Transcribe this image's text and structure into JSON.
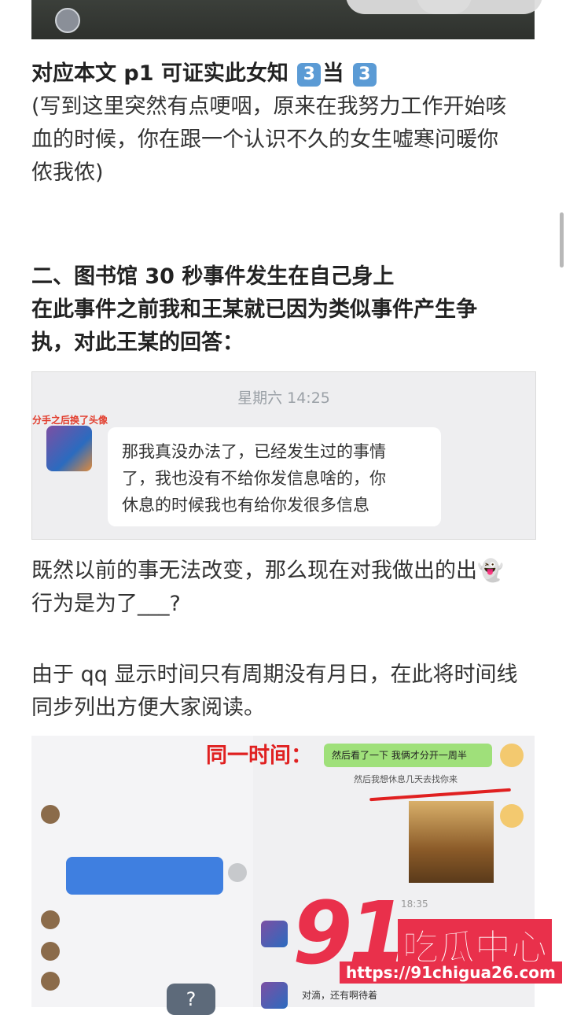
{
  "article": {
    "line1_prefix": "对应本文 p1 可证实此女知",
    "line1_badge1": "3",
    "line1_mid": "当",
    "line1_badge2": "3",
    "para1": [
      "(写到这里突然有点哽咽，原来在我努力工作开始咳",
      "血的时候，你在跟一个认识不久的女生嘘寒问暖你",
      "侬我侬)"
    ],
    "section2_title": "二、图书馆 30 秒事件发生在自己身上",
    "section2_lines": [
      "在此事件之前我和王某就已因为类似事件产生争",
      "执，对此王某的回答："
    ],
    "para2": [
      "既然以前的事无法改变，那么现在对我做出的出👻",
      "行为是为了___?"
    ],
    "para3": [
      "由于 qq 显示时间只有周期没有月日，在此将时间线",
      "同步列出方便大家阅读。"
    ]
  },
  "chat": {
    "time": "星期六 14:25",
    "note": "分手之后换了头像",
    "message": [
      "那我真没办法了，已经发生过的事情",
      "了，我也没有不给你发信息啥的，你",
      "休息的时候我也有给你发很多信息"
    ]
  },
  "shot": {
    "same_time": "同一时间：",
    "green_msg": "然后看了一下 我俩才分开一周半",
    "gray_msg": "然后我想休息几天去找你来",
    "time2": "18:35",
    "bottom_msg": "对滴，还有啊待着",
    "q_label": "?"
  },
  "watermark": {
    "num": "91",
    "text": "吃瓜中心",
    "url": "https://91chigua26.com"
  }
}
